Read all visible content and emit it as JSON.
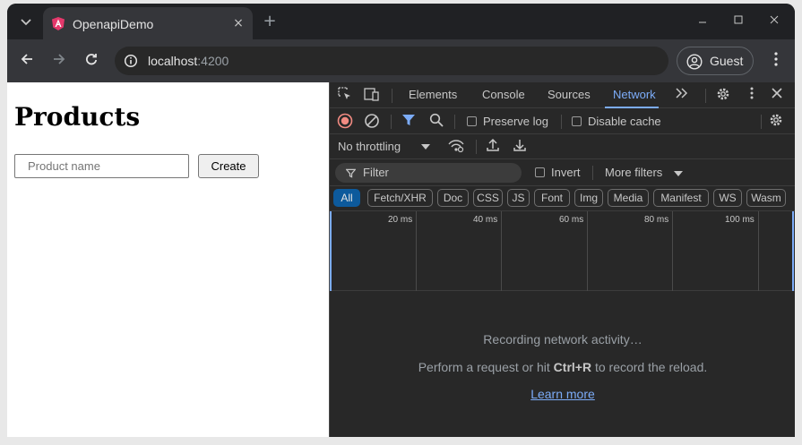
{
  "browser": {
    "tab_title": "OpenapiDemo",
    "url_host": "localhost",
    "url_port": ":4200",
    "profile_label": "Guest",
    "new_tab_symbol": "+",
    "close_symbol": "×"
  },
  "page": {
    "heading": "Products",
    "input_placeholder": "Product name",
    "create_label": "Create"
  },
  "devtools": {
    "tabs": [
      "Elements",
      "Console",
      "Sources",
      "Network"
    ],
    "active_tab": "Network",
    "preserve_log": "Preserve log",
    "disable_cache": "Disable cache",
    "throttling": "No throttling",
    "filter_placeholder": "Filter",
    "invert": "Invert",
    "more_filters": "More filters",
    "type_filters": [
      "All",
      "Fetch/XHR",
      "Doc",
      "CSS",
      "JS",
      "Font",
      "Img",
      "Media",
      "Manifest",
      "WS",
      "Wasm"
    ],
    "timeline_labels": [
      "20 ms",
      "40 ms",
      "60 ms",
      "80 ms",
      "100 ms"
    ],
    "recording_text": "Recording network activity…",
    "perform_prefix": "Perform a request or hit ",
    "perform_shortcut": "Ctrl+R",
    "perform_suffix": " to record the reload.",
    "learn_more": "Learn more"
  },
  "colors": {
    "accent": "#7cacf8",
    "record_red": "#f28b82",
    "filter_blue": "#7cacf8"
  }
}
